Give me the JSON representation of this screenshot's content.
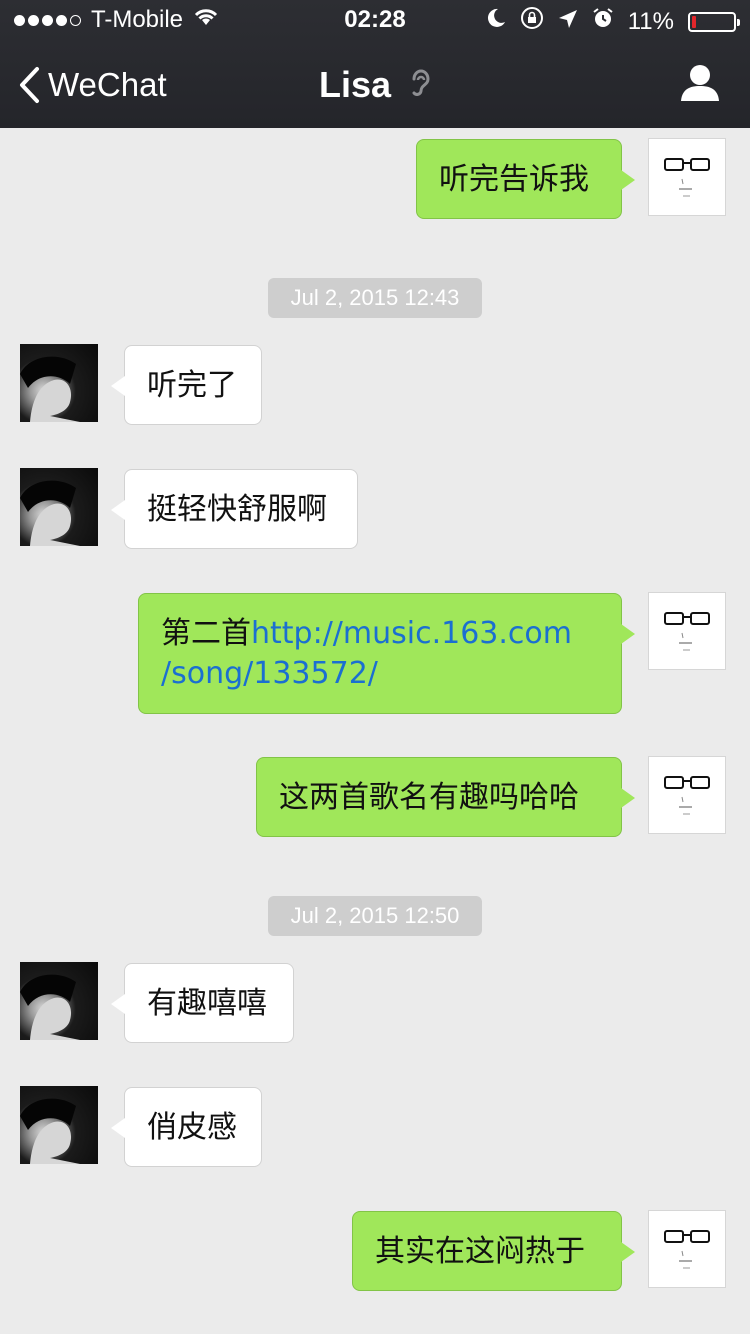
{
  "status_bar": {
    "carrier": "T-Mobile",
    "time": "02:28",
    "battery_percent": "11%",
    "battery_level": 0.11,
    "battery_color": "#e2262b"
  },
  "nav": {
    "back_label": "WeChat",
    "title": "Lisa"
  },
  "timestamps": [
    "Jul 2, 2015 12:43",
    "Jul 2, 2015 12:50"
  ],
  "messages": [
    {
      "from": "me",
      "text": "听完告诉我"
    },
    {
      "from": "Lisa",
      "text": "听完了"
    },
    {
      "from": "Lisa",
      "text": "挺轻快舒服啊"
    },
    {
      "from": "me",
      "prefix": "第二首",
      "link_line1": "http://music.163.com",
      "link_line2": "/song/133572/"
    },
    {
      "from": "me",
      "text": "这两首歌名有趣吗哈哈"
    },
    {
      "from": "Lisa",
      "text": "有趣嘻嘻"
    },
    {
      "from": "Lisa",
      "text": "俏皮感"
    },
    {
      "from": "me",
      "text": "其实在这闷热于"
    }
  ],
  "colors": {
    "outgoing_bubble": "#a0e75a",
    "incoming_bubble": "#ffffff",
    "link": "#1b6fd1",
    "background": "#ebebeb"
  },
  "icons": [
    "wifi-icon",
    "moon-icon",
    "rotation-lock-icon",
    "location-arrow-icon",
    "alarm-icon",
    "battery-icon",
    "back-chevron-icon",
    "ear-icon",
    "profile-icon"
  ]
}
